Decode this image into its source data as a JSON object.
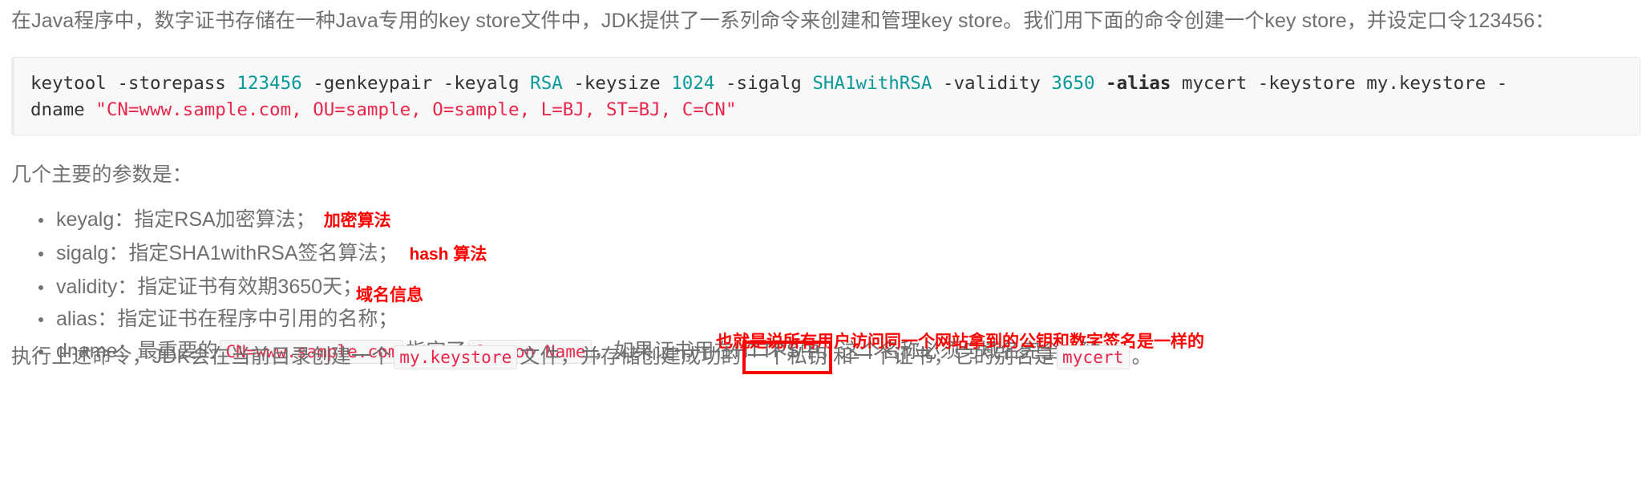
{
  "intro": {
    "text": "在Java程序中，数字证书存储在一种Java专用的key store文件中，JDK提供了一系列命令来创建和管理key store。我们用下面的命令创建一个key store，并设定口令123456："
  },
  "code_block": {
    "language": "shell",
    "line1": {
      "seg1": "keytool -storepass ",
      "password": "123456",
      "seg2": " -genkeypair -keyalg ",
      "keyalg": "RSA",
      "seg3": " -keysize ",
      "keysize": "1024",
      "seg4": " -sigalg ",
      "sigalg": "SHA1withRSA",
      "seg5": " -validity ",
      "validity": "3650",
      "seg6": " ",
      "alias_flag": "-alias",
      "seg7": " mycert -keystore my.keystore -"
    },
    "line2": {
      "seg1": "dname ",
      "dname_value": "\"CN=www.sample.com, OU=sample, O=sample, L=BJ, ST=BJ, C=CN\""
    }
  },
  "params_heading": "几个主要的参数是：",
  "params": [
    {
      "label": "keyalg：",
      "desc": "指定RSA加密算法；",
      "annotation": "加密算法"
    },
    {
      "label": "sigalg：",
      "desc": "指定SHA1withRSA签名算法；",
      "annotation": "hash 算法"
    },
    {
      "label": "validity：",
      "desc": "指定证书有效期3650天；",
      "annotation": ""
    },
    {
      "label": "alias：",
      "desc": "指定证书在程序中引用的名称；",
      "annotation": ""
    }
  ],
  "dname_item": {
    "label": "dname：",
    "text_before": "最重要的",
    "code_cn": "CN=www.sample.com",
    "text_mid": "指定了",
    "code_common_name": "Common Name",
    "text_after": "，如果证书用在HTTPS中，这个名称必须与域名完全一致。"
  },
  "floating_annotations": {
    "domain_info": "域名信息",
    "pubkey_note": "也就是说所有用户访问同一个网站拿到的公钥和数字签名是一样的"
  },
  "closing": {
    "part1": "执行上述命令，JDK会在当前目录创建一个",
    "code_keystore": "my.keystore",
    "part2": "文件，并存储创建成功的",
    "boxed": "一个私钥",
    "part3": "和一个证书，它的别名是",
    "code_mycert": "mycert",
    "part4": "。"
  },
  "colors": {
    "body_text": "#707070",
    "code_text": "#333333",
    "code_constant": "#0b9a9a",
    "code_string": "#e8274b",
    "annotation_red": "#ff0000",
    "inline_code": "#e8274b",
    "code_bg": "#f8f8f8"
  }
}
